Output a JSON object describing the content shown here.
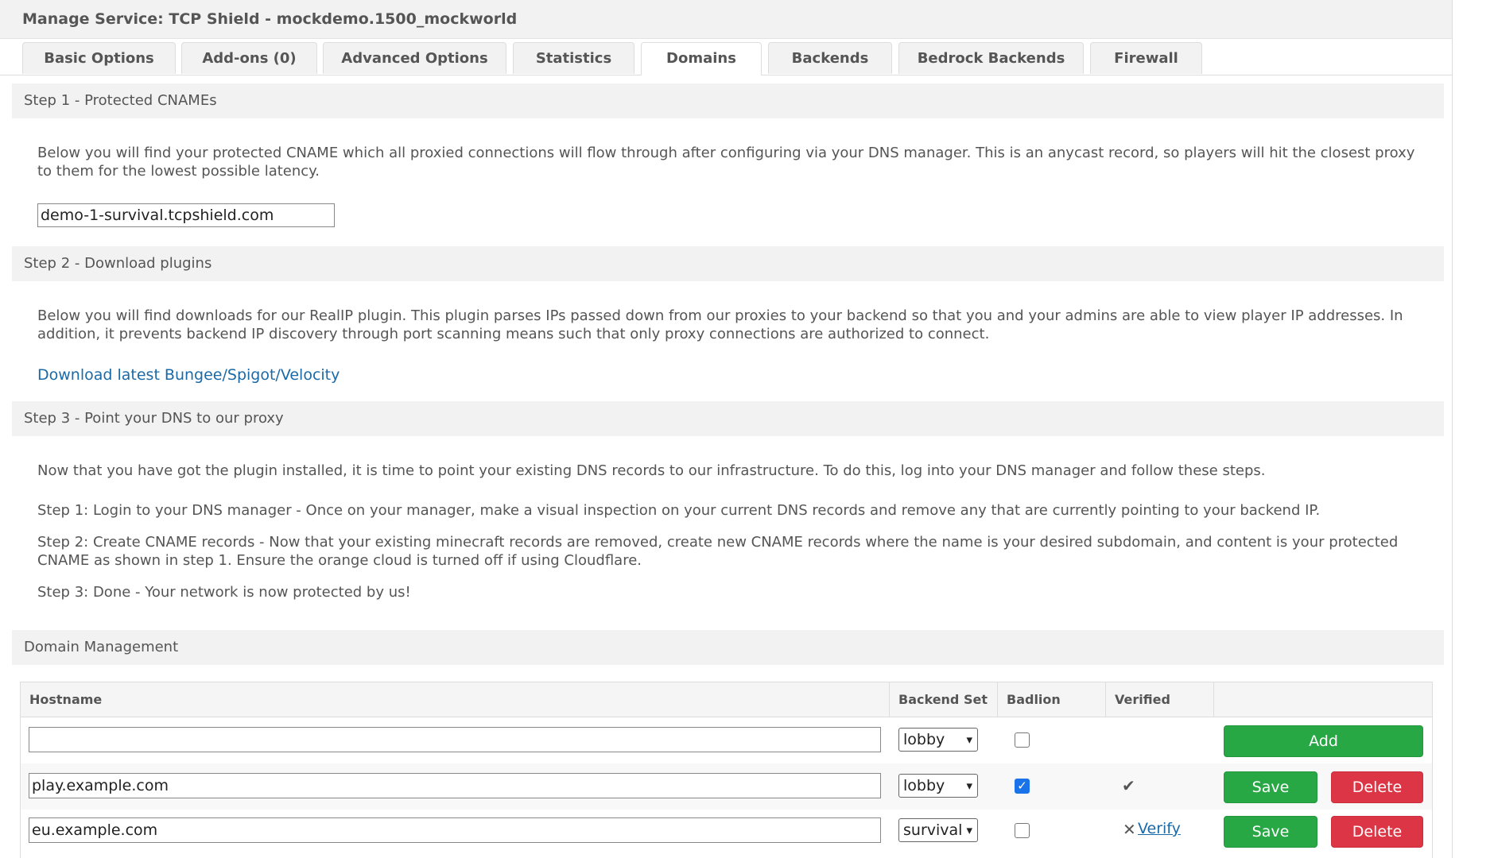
{
  "header": {
    "title": "Manage Service: TCP Shield - mockdemo.1500_mockworld"
  },
  "tabs": [
    {
      "label": "Basic Options"
    },
    {
      "label": "Add-ons (0)"
    },
    {
      "label": "Advanced Options"
    },
    {
      "label": "Statistics"
    },
    {
      "label": "Domains",
      "active": true
    },
    {
      "label": "Backends"
    },
    {
      "label": "Bedrock Backends"
    },
    {
      "label": "Firewall"
    }
  ],
  "step1": {
    "title": "Step 1 - Protected CNAMEs",
    "text": "Below you will find your protected CNAME which all proxied connections will flow through after configuring via your DNS manager. This is an anycast record, so players will hit the closest proxy to them for the lowest possible latency.",
    "cname_value": "demo-1-survival.tcpshield.com"
  },
  "step2": {
    "title": "Step 2 - Download plugins",
    "text": "Below you will find downloads for our RealIP plugin. This plugin parses IPs passed down from our proxies to your backend so that you and your admins are able to view player IP addresses. In addition, it prevents backend IP discovery through port scanning means such that only proxy connections are authorized to connect.",
    "download_link": "Download latest Bungee/Spigot/Velocity"
  },
  "step3": {
    "title": "Step 3 - Point your DNS to our proxy",
    "intro": "Now that you have got the plugin installed, it is time to point your existing DNS records to our infrastructure. To do this, log into your DNS manager and follow these steps.",
    "s1": "Step 1: Login to your DNS manager - Once on your manager, make a visual inspection on your current DNS records and remove any that are currently pointing to your backend IP.",
    "s2": "Step 2: Create CNAME records - Now that your existing minecraft records are removed, create new CNAME records where the name is your desired subdomain, and content is your protected CNAME as shown in step 1. Ensure the orange cloud is turned off if using Cloudflare.",
    "s3": "Step 3: Done - Your network is now protected by us!"
  },
  "domain_mgmt": {
    "title": "Domain Management",
    "columns": [
      "Hostname",
      "Backend Set",
      "Badlion",
      "Verified",
      ""
    ],
    "new_row": {
      "hostname": "",
      "backend": "lobby",
      "badlion": false,
      "add_label": "Add"
    },
    "rows": [
      {
        "hostname": "play.example.com",
        "backend": "lobby",
        "badlion": true,
        "verified": true,
        "save_label": "Save",
        "delete_label": "Delete"
      },
      {
        "hostname": "eu.example.com",
        "backend": "survival",
        "badlion": false,
        "verified": false,
        "verify_label": "Verify",
        "save_label": "Save",
        "delete_label": "Delete"
      }
    ]
  },
  "icons": {
    "check": "check-icon",
    "cross": "cross-icon",
    "chevron": "chevron-down-icon"
  },
  "colors": {
    "green": "#28a745",
    "red": "#dc3545",
    "link": "#1a6aa8",
    "header_bg": "#f2f2f2"
  }
}
